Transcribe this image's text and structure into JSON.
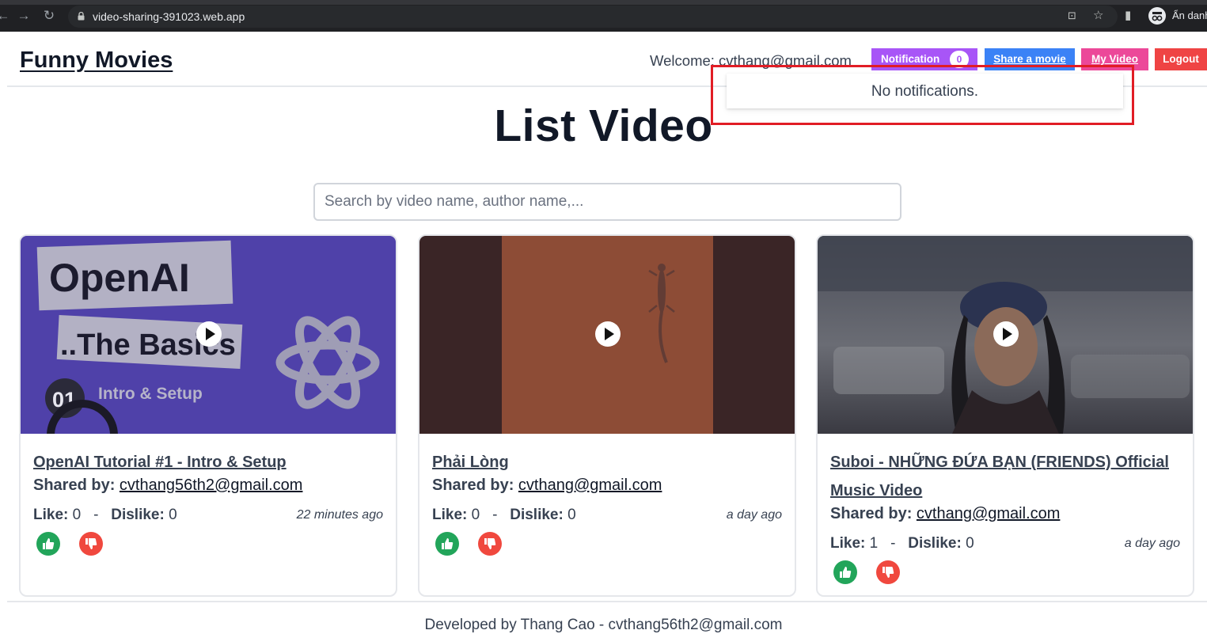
{
  "browser": {
    "url": "video-sharing-391023.web.app",
    "profile_label": "Ẩn danh"
  },
  "header": {
    "brand": "Funny Movies",
    "welcome": "Welcome: cvthang@gmail.com",
    "notification_label": "Notification",
    "notification_count": "0",
    "share_label": "Share a movie",
    "my_video_label": "My Video",
    "logout_label": "Logout"
  },
  "notifications": {
    "empty_text": "No notifications."
  },
  "main": {
    "title": "List Video",
    "search_placeholder": "Search by video name, author name,..."
  },
  "labels": {
    "shared_by": "Shared by:",
    "like": "Like:",
    "dislike": "Dislike:",
    "separator": "-"
  },
  "videos": [
    {
      "title": "OpenAI Tutorial #1 - Intro & Setup",
      "shared_by": "cvthang56th2@gmail.com",
      "likes": "0",
      "dislikes": "0",
      "time_ago": "22 minutes ago",
      "thumb": {
        "line1": "OpenAI",
        "line2": "..The Basics",
        "number": "01",
        "caption": "Intro & Setup"
      }
    },
    {
      "title": "Phải Lòng",
      "shared_by": "cvthang@gmail.com",
      "likes": "0",
      "dislikes": "0",
      "time_ago": "a day ago"
    },
    {
      "title": "Suboi - NHỮNG ĐỨA BẠN (FRIENDS) Official Music Video",
      "shared_by": "cvthang@gmail.com",
      "likes": "1",
      "dislikes": "0",
      "time_ago": "a day ago"
    }
  ],
  "footer": {
    "text": "Developed by Thang Cao - cvthang56th2@gmail.com"
  },
  "colors": {
    "notification": "#a855f7",
    "share": "#3b82f6",
    "my_video": "#ec4899",
    "logout": "#ef4444",
    "like": "#22a55a",
    "dislike": "#f0483e",
    "highlight": "#e11d25"
  },
  "icons": [
    "back-arrow-icon",
    "forward-arrow-icon",
    "reload-icon",
    "lock-icon",
    "translate-icon",
    "star-icon",
    "sidepanel-icon",
    "incognito-icon",
    "play-icon",
    "thumbs-up-icon",
    "thumbs-down-icon"
  ]
}
